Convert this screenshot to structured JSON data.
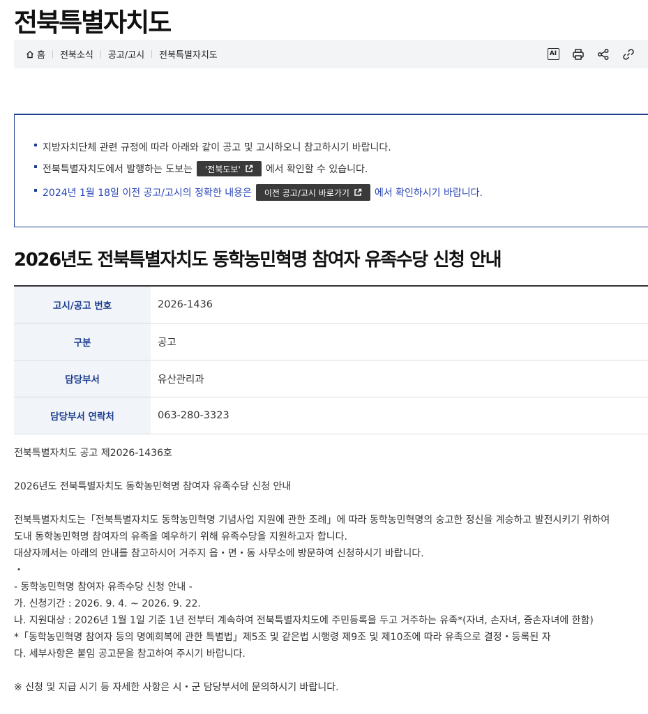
{
  "site": {
    "title": "전북특별자치도"
  },
  "breadcrumb": [
    "홈",
    "전북소식",
    "공고/고시",
    "전북특별자치도"
  ],
  "tools": {
    "ai_label": "AI"
  },
  "notice": {
    "line1": "지방자치단체 관련 규정에 따라 아래와 같이 공고 및 고시하오니 참고하시기 바랍니다.",
    "line2_before": "전북특별자치도에서 발행하는 도보는",
    "line2_button": "'전북도보'",
    "line2_after": "에서 확인할 수 있습니다.",
    "line3_before": "2024년 1월 18일 이전 공고/고시의 정확한 내용은",
    "line3_button": "이전 공고/고시 바로가기",
    "line3_after": "에서 확인하시기 바랍니다."
  },
  "post": {
    "title": "2026년도 전북특별자치도 동학농민혁명 참여자 유족수당 신청 안내",
    "rows": [
      {
        "label": "고시/공고 번호",
        "value": "2026-1436"
      },
      {
        "label": "구분",
        "value": "공고"
      },
      {
        "label": "담당부서",
        "value": "유산관리과"
      },
      {
        "label": "담당부서 연락처",
        "value": "063-280-3323"
      }
    ],
    "body": [
      "전북특별자치도 공고 제2026-1436호",
      "",
      "2026년도 전북특별자치도 동학농민혁명 참여자 유족수당 신청 안내",
      "",
      "전북특별자치도는「전북특별자치도 동학농민혁명 기념사업 지원에 관한 조례」에 따라 동학농민혁명의 숭고한 정신을 계승하고 발전시키기 위하여",
      "도내 동학농민혁명 참여자의 유족을 예우하기 위해 유족수당을 지원하고자 합니다.",
      "대상자께서는 아래의 안내를 참고하시어 거주지 읍・면・동 사무소에 방문하여 신청하시기 바랍니다.",
      "・",
      "- 동학농민혁명 참여자 유족수당 신청 안내 -",
      "가. 신청기간 : 2026. 9. 4. ~ 2026. 9. 22.",
      "나. 지원대상 : 2026년 1월 1일 기준 1년 전부터 계속하여 전북특별자치도에 주민등록을 두고 거주하는 유족*(자녀, 손자녀, 증손자녀에 한함)",
      "*「동학농민혁명 참여자 등의 명예회복에 관한 특별법」제5조 및 같은법 시행령 제9조 및 제10조에 따라 유족으로 결정・등록된 자",
      "다. 세부사항은 붙임 공고문을 참고하여 주시기 바랍니다.",
      "",
      "※ 신청 및 지급 시기 등 자세한 사항은 시・군 담당부서에 문의하시기 바랍니다."
    ]
  }
}
